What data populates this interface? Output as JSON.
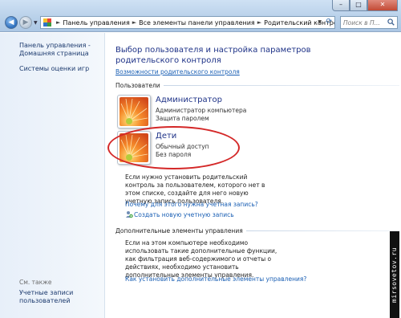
{
  "window": {
    "controls": {
      "minimize": "–",
      "maximize": "□",
      "close": "✕"
    }
  },
  "nav": {
    "back_icon": "arrow-left-icon",
    "forward_icon": "arrow-right-icon"
  },
  "breadcrumbs": [
    "Панель управления",
    "Все элементы панели управления",
    "Родительский контроль"
  ],
  "search": {
    "placeholder": "Поиск в П..."
  },
  "sidebar": {
    "home_link": "Панель управления - Домашняя страница",
    "ratings_link": "Системы оценки игр",
    "see_also": "См. также",
    "accounts_link": "Учетные записи пользователей"
  },
  "main": {
    "title": "Выбор пользователя и настройка параметров родительского контроля",
    "help_link": "Возможности родительского контроля",
    "users_header": "Пользователи",
    "users": [
      {
        "name": "Администратор",
        "type": "Администратор компьютера",
        "password": "Защита паролем"
      },
      {
        "name": "Дети",
        "type": "Обычный доступ",
        "password": "Без пароля"
      }
    ],
    "add_account_text": "Если нужно установить родительский контроль за пользователем, которого нет в этом списке, создайте для него новую учетную запись пользователя.",
    "why_link": "Почему для этого нужна учетная запись?",
    "create_link": "Создать новую учетную запись",
    "extra_header": "Дополнительные элементы управления",
    "extra_text": "Если на этом компьютере необходимо использовать такие дополнительные функции, как фильтрация веб-содержимого и отчеты о действиях, необходимо установить дополнительные элементы управления.",
    "how_link": "Как установить дополнительные элементы управления?"
  },
  "watermark": "mirsovetov.ru",
  "colors": {
    "highlight_ring": "#d42828",
    "link": "#1a5fb4",
    "title": "#1e3287"
  }
}
